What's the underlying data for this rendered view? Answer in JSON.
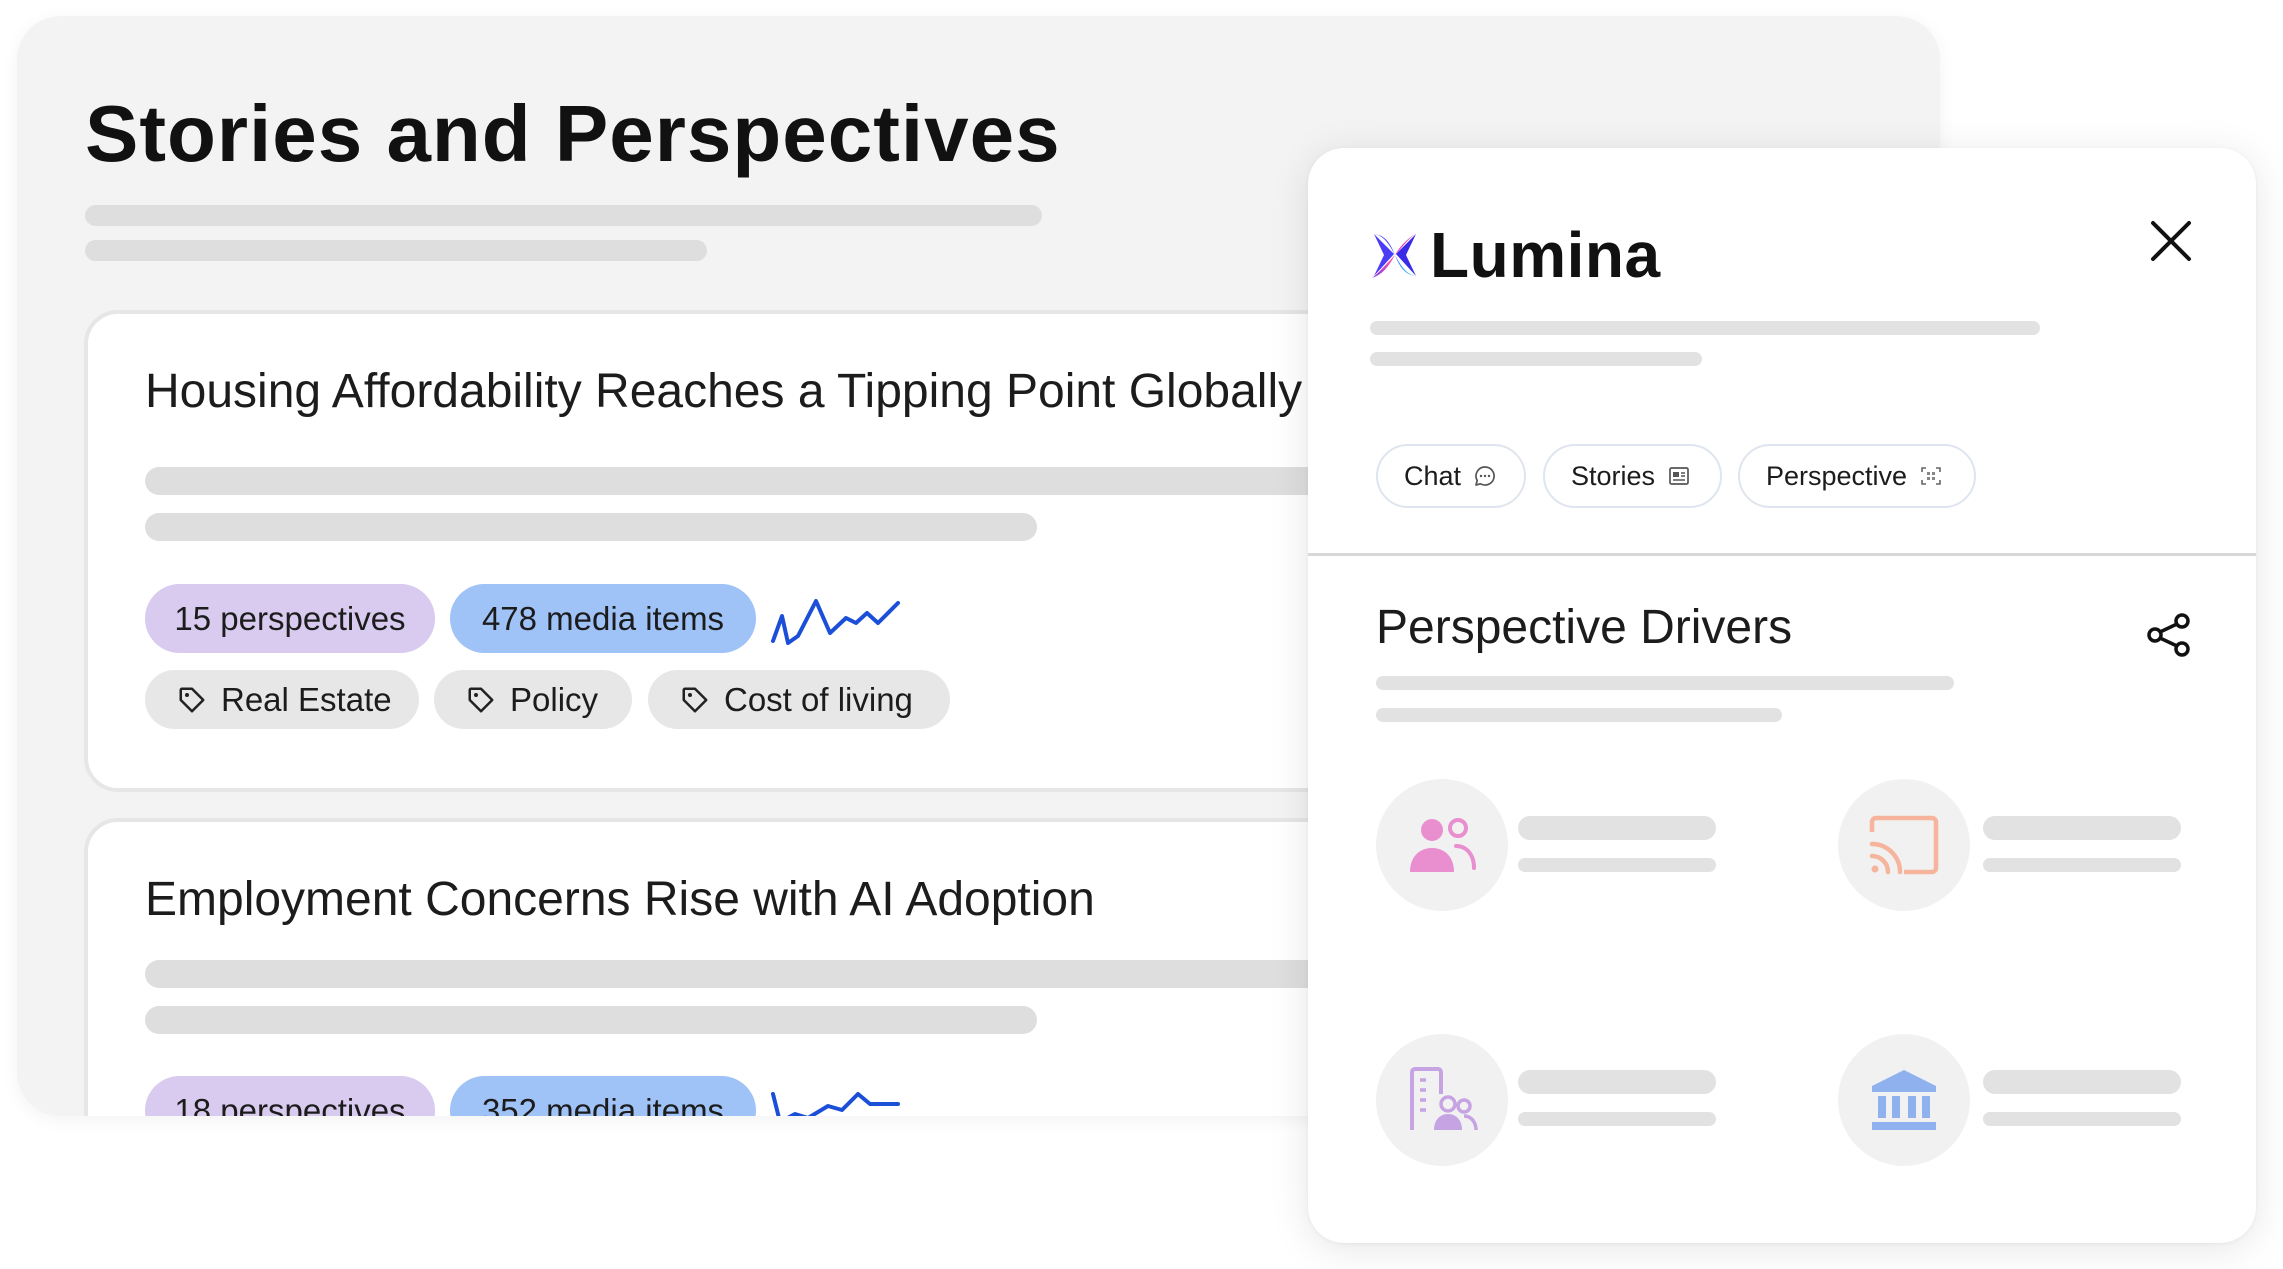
{
  "page": {
    "title": "Stories and Perspectives"
  },
  "stories": [
    {
      "title": "Housing Affordability Reaches a Tipping Point Globally",
      "perspectives": "15 perspectives",
      "media_items": "478 media items",
      "tags": [
        "Real Estate",
        "Policy",
        "Cost of living"
      ]
    },
    {
      "title": "Employment Concerns Rise with AI Adoption",
      "perspectives": "18 perspectives",
      "media_items": "352 media items",
      "tags": []
    }
  ],
  "panel": {
    "brand": "Lumina",
    "tabs": [
      {
        "label": "Chat",
        "icon": "chat-bubble-icon"
      },
      {
        "label": "Stories",
        "icon": "newspaper-icon"
      },
      {
        "label": "Perspective",
        "icon": "focus-frame-icon"
      }
    ],
    "section_title": "Perspective Drivers",
    "drivers": [
      {
        "icon": "people-icon",
        "color": "#e98fd0"
      },
      {
        "icon": "cast-icon",
        "color": "#f6b49c"
      },
      {
        "icon": "building-person-icon",
        "color": "#c6a3e3"
      },
      {
        "icon": "institution-icon",
        "color": "#8fb2ef"
      }
    ]
  },
  "colors": {
    "sparkline": "#1c4fd8",
    "perspectives_pill": "#d8cbef",
    "media_pill": "#9fc2f7",
    "tag_bg": "#e7e7e7"
  }
}
